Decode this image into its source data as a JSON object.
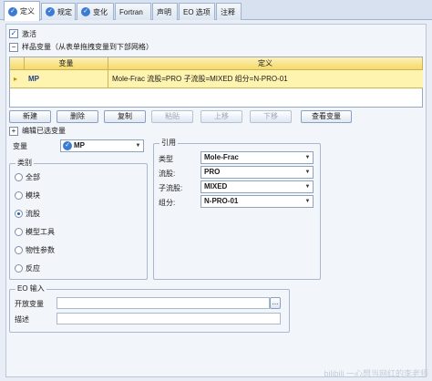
{
  "tabs": [
    {
      "label": "定义",
      "active": true
    },
    {
      "label": "规定",
      "active": false
    },
    {
      "label": "变化",
      "active": false
    },
    {
      "label": "Fortran",
      "active": false
    },
    {
      "label": "声明",
      "active": false
    },
    {
      "label": "EO 选项",
      "active": false
    },
    {
      "label": "注释",
      "active": false
    }
  ],
  "activate": {
    "label": "激活",
    "checked": true
  },
  "sample_vars": {
    "label": "样品变量（从表单拖拽变量到下部网格）",
    "columns": [
      "变量",
      "定义"
    ],
    "rows": [
      {
        "variable": "MP",
        "definition": "Mole-Frac 流股=PRO 子流股=MIXED 组分=N-PRO-01"
      }
    ]
  },
  "buttons": {
    "new": "新建",
    "delete": "删除",
    "copy": "复制",
    "paste": "粘贴",
    "move_up": "上移",
    "move_down": "下移",
    "view_vars": "查看变量"
  },
  "edit_selected": {
    "label": "编辑已选变量",
    "expanded": true
  },
  "variable": {
    "label": "变量",
    "value": "MP"
  },
  "category": {
    "label": "类别",
    "options": [
      "全部",
      "模块",
      "流股",
      "模型工具",
      "物性参数",
      "反应"
    ],
    "selected": "流股"
  },
  "reference": {
    "label": "引用",
    "fields": [
      {
        "label": "类型",
        "value": "Mole-Frac"
      },
      {
        "label": "流股:",
        "value": "PRO"
      },
      {
        "label": "子流股:",
        "value": "MIXED"
      },
      {
        "label": "组分:",
        "value": "N-PRO-01"
      }
    ]
  },
  "eo_input": {
    "label": "EO 输入",
    "open_var_label": "开放变量",
    "open_var_button": "...",
    "description_label": "描述"
  },
  "watermark": "bilibili 一心想当网红的李老师"
}
